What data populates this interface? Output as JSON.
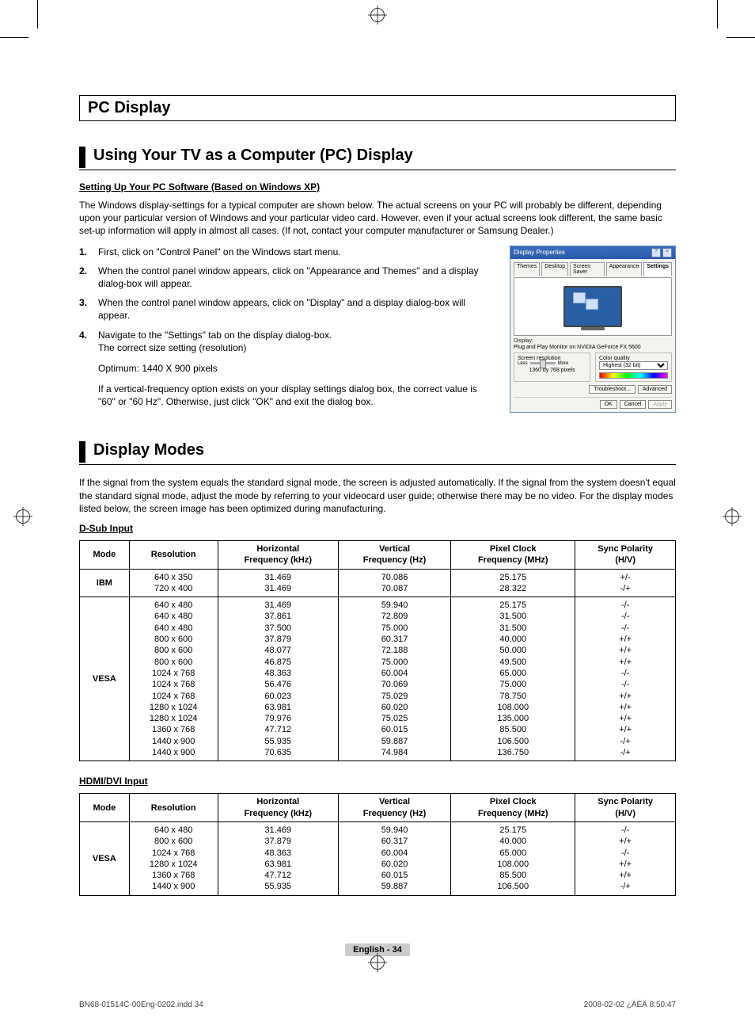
{
  "h1": "PC Display",
  "section1": {
    "title": "Using Your TV as a Computer (PC) Display",
    "subhead": "Setting Up Your PC Software (Based on Windows XP)",
    "para": "The Windows display-settings for a typical computer are shown below. The actual screens on your PC will probably be different, depending upon your particular version of Windows and your particular video card. However, even if your actual screens look different, the same basic set-up information will apply in almost all cases. (If not, contact your computer manufacturer or Samsung Dealer.)",
    "steps": [
      {
        "n": "1.",
        "t": "First, click on \"Control Panel\" on the Windows start menu."
      },
      {
        "n": "2.",
        "t": "When the control panel window appears, click on \"Appearance and Themes\" and a display dialog-box will appear."
      },
      {
        "n": "3.",
        "t": "When the control panel window appears, click on \"Display\" and a display dialog-box will appear."
      },
      {
        "n": "4.",
        "t": "Navigate to the \"Settings\" tab on the display dialog-box.\nThe correct size setting (resolution)"
      }
    ],
    "optimum": "Optimum: 1440 X 900 pixels",
    "vfreq": "If a vertical-frequency option exists on your display settings dialog box, the correct value is \"60\" or \"60 Hz\". Otherwise, just click \"OK\" and exit the dialog box."
  },
  "dialog": {
    "title": "Display Properties",
    "tabs": [
      "Themes",
      "Desktop",
      "Screen Saver",
      "Appearance",
      "Settings"
    ],
    "active_tab": 4,
    "display_label": "Display:",
    "display_value": "Plug and Play Monitor on NVIDIA GeForce FX 5600",
    "res_group": "Screen resolution",
    "less": "Less",
    "more": "More",
    "res_value": "1360 by 768 pixels",
    "quality_group": "Color quality",
    "quality_value": "Highest (32 bit)",
    "troubleshoot": "Troubleshoot...",
    "advanced": "Advanced",
    "ok": "OK",
    "cancel": "Cancel",
    "apply": "Apply"
  },
  "section2": {
    "title": "Display Modes",
    "para": "If the signal from the system equals the standard signal mode, the screen is adjusted automatically.  If the signal from the system doesn't equal the standard signal mode, adjust the mode by referring to your videocard user guide; otherwise there may be no video. For the display modes listed below, the screen image has been optimized during manufacturing.",
    "sub1": "D-Sub Input",
    "sub2": "HDMI/DVI Input",
    "headers": {
      "mode": "Mode",
      "resolution": "Resolution",
      "hfreq_l1": "Horizontal",
      "hfreq_l2": "Frequency (kHz)",
      "vfreq_l1": "Vertical",
      "vfreq_l2": "Frequency (Hz)",
      "pclk_l1": "Pixel Clock",
      "pclk_l2": "Frequency (MHz)",
      "sync_l1": "Sync Polarity",
      "sync_l2": "(H/V)"
    }
  },
  "chart_data": {
    "type": "table",
    "dsub": [
      {
        "mode": "IBM",
        "rows": [
          {
            "res": "640 x 350",
            "h": "31.469",
            "v": "70.086",
            "p": "25.175",
            "s": "+/-"
          },
          {
            "res": "720 x 400",
            "h": "31.469",
            "v": "70.087",
            "p": "28.322",
            "s": "-/+"
          }
        ]
      },
      {
        "mode": "VESA",
        "rows": [
          {
            "res": "640 x 480",
            "h": "31.469",
            "v": "59.940",
            "p": "25.175",
            "s": "-/-"
          },
          {
            "res": "640 x 480",
            "h": "37.861",
            "v": "72.809",
            "p": "31.500",
            "s": "-/-"
          },
          {
            "res": "640 x 480",
            "h": "37.500",
            "v": "75.000",
            "p": "31.500",
            "s": "-/-"
          },
          {
            "res": "800 x 600",
            "h": "37.879",
            "v": "60.317",
            "p": "40.000",
            "s": "+/+"
          },
          {
            "res": "800 x 600",
            "h": "48.077",
            "v": "72.188",
            "p": "50.000",
            "s": "+/+"
          },
          {
            "res": "800 x 600",
            "h": "46.875",
            "v": "75.000",
            "p": "49.500",
            "s": "+/+"
          },
          {
            "res": "1024 x 768",
            "h": "48.363",
            "v": "60.004",
            "p": "65.000",
            "s": "-/-"
          },
          {
            "res": "1024 x 768",
            "h": "56.476",
            "v": "70.069",
            "p": "75.000",
            "s": "-/-"
          },
          {
            "res": "1024 x 768",
            "h": "60.023",
            "v": "75.029",
            "p": "78.750",
            "s": "+/+"
          },
          {
            "res": "1280 x 1024",
            "h": "63.981",
            "v": "60.020",
            "p": "108.000",
            "s": "+/+"
          },
          {
            "res": "1280 x 1024",
            "h": "79.976",
            "v": "75.025",
            "p": "135.000",
            "s": "+/+"
          },
          {
            "res": "1360 x 768",
            "h": "47.712",
            "v": "60.015",
            "p": "85.500",
            "s": "+/+"
          },
          {
            "res": "1440 x 900",
            "h": "55.935",
            "v": "59.887",
            "p": "106.500",
            "s": "-/+"
          },
          {
            "res": "1440 x 900",
            "h": "70.635",
            "v": "74.984",
            "p": "136.750",
            "s": "-/+"
          }
        ]
      }
    ],
    "hdmi": [
      {
        "mode": "VESA",
        "rows": [
          {
            "res": "640 x 480",
            "h": "31.469",
            "v": "59.940",
            "p": "25.175",
            "s": "-/-"
          },
          {
            "res": "800 x 600",
            "h": "37.879",
            "v": "60.317",
            "p": "40.000",
            "s": "+/+"
          },
          {
            "res": "1024 x 768",
            "h": "48.363",
            "v": "60.004",
            "p": "65.000",
            "s": "-/-"
          },
          {
            "res": "1280 x 1024",
            "h": "63.981",
            "v": "60.020",
            "p": "108.000",
            "s": "+/+"
          },
          {
            "res": "1360 x 768",
            "h": "47.712",
            "v": "60.015",
            "p": "85.500",
            "s": "+/+"
          },
          {
            "res": "1440 x 900",
            "h": "55.935",
            "v": "59.887",
            "p": "106.500",
            "s": "-/+"
          }
        ]
      }
    ]
  },
  "footer": {
    "badge": "English - 34",
    "left": "BN68-01514C-00Eng-0202.indd   34",
    "right": "2008-02-02   ¿ÀÈÄ 8:50:47"
  }
}
